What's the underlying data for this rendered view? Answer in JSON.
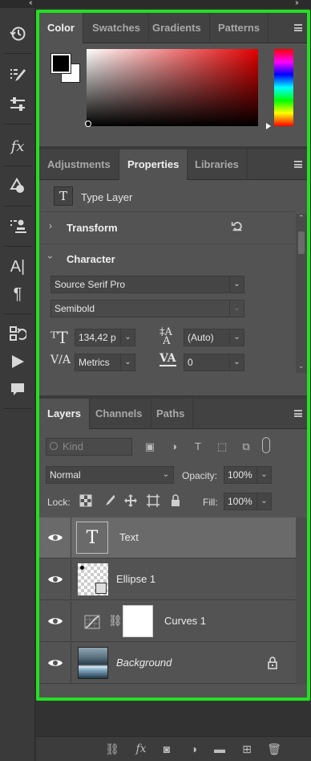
{
  "color_panel": {
    "tabs": [
      "Color",
      "Swatches",
      "Gradients",
      "Patterns"
    ],
    "active_tab": "Color",
    "foreground_color": "#000000",
    "background_color": "#ffffff",
    "picker_hue_color": "#e40000"
  },
  "properties_panel": {
    "tabs": [
      "Adjustments",
      "Properties",
      "Libraries"
    ],
    "active_tab": "Properties",
    "layer_kind_icon": "T",
    "layer_kind_label": "Type Layer",
    "transform_label": "Transform",
    "character_label": "Character",
    "font_family": "Source Serif Pro",
    "font_style": "Semibold",
    "font_size": "134,42 p",
    "leading": "(Auto)",
    "kerning": "Metrics",
    "tracking": "0"
  },
  "layers_panel": {
    "tabs": [
      "Layers",
      "Channels",
      "Paths"
    ],
    "active_tab": "Layers",
    "filter_placeholder": "Kind",
    "blend_mode": "Normal",
    "opacity_label": "Opacity:",
    "opacity_value": "100%",
    "lock_label": "Lock:",
    "fill_label": "Fill:",
    "fill_value": "100%",
    "layers": [
      {
        "name": "Text",
        "type": "text",
        "selected": true
      },
      {
        "name": "Ellipse 1",
        "type": "shape",
        "selected": false
      },
      {
        "name": "Curves 1",
        "type": "adjustment",
        "selected": false
      },
      {
        "name": "Background",
        "type": "image",
        "selected": false,
        "locked": true
      }
    ]
  },
  "colors": {
    "selection_outline": "#22e022",
    "panel_bg": "#535353",
    "tab_bar_bg": "#424242"
  }
}
